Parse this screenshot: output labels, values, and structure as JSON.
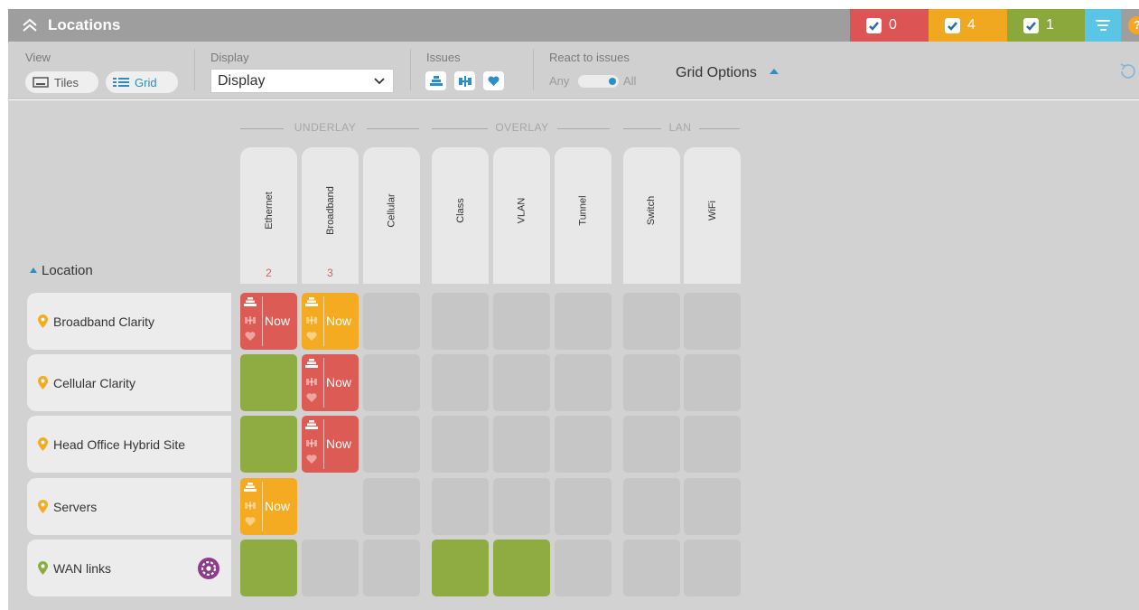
{
  "header": {
    "title": "Locations",
    "badges": {
      "red": "0",
      "orange": "4",
      "green": "1"
    },
    "help": "?"
  },
  "toolbar": {
    "view_label": "View",
    "tiles_label": "Tiles",
    "grid_label": "Grid",
    "display_label": "Display",
    "display_value": "Display",
    "issues_label": "Issues",
    "react_label": "React to issues",
    "react_any": "Any",
    "react_all": "All",
    "react_selected": "All",
    "grid_options": "Grid Options"
  },
  "groups": {
    "underlay": "UNDERLAY",
    "overlay": "OVERLAY",
    "lan": "LAN"
  },
  "location_header": "Location",
  "columns": [
    {
      "label": "Ethernet",
      "count": "2"
    },
    {
      "label": "Broadband",
      "count": "3"
    },
    {
      "label": "Cellular",
      "count": ""
    },
    {
      "label": "Class",
      "count": ""
    },
    {
      "label": "VLAN",
      "count": ""
    },
    {
      "label": "Tunnel",
      "count": ""
    },
    {
      "label": "Switch",
      "count": ""
    },
    {
      "label": "WiFi",
      "count": ""
    }
  ],
  "rows": [
    {
      "name": "Broadband Clarity",
      "pin": "orange",
      "cells": [
        "red-now",
        "orange-now",
        "empty",
        "empty",
        "empty",
        "empty",
        "empty",
        "empty"
      ]
    },
    {
      "name": "Cellular Clarity",
      "pin": "orange",
      "cells": [
        "green",
        "red-now",
        "empty",
        "empty",
        "empty",
        "empty",
        "empty",
        "empty"
      ]
    },
    {
      "name": "Head Office Hybrid Site",
      "pin": "orange",
      "cells": [
        "green",
        "red-now",
        "empty",
        "empty",
        "empty",
        "empty",
        "empty",
        "empty"
      ]
    },
    {
      "name": "Servers",
      "pin": "orange",
      "cells": [
        "orange-now",
        "none",
        "empty",
        "empty",
        "empty",
        "empty",
        "empty",
        "empty"
      ]
    },
    {
      "name": "WAN links",
      "pin": "green",
      "cells": [
        "green",
        "empty",
        "empty",
        "green",
        "green",
        "empty",
        "empty",
        "empty"
      ],
      "has_gear": true
    }
  ],
  "now_label": "Now",
  "colors": {
    "red": "#dc5c55",
    "orange": "#f4ab22",
    "green": "#8fac43",
    "accent": "#2a8fc6",
    "empty": "#c6c6c6"
  }
}
